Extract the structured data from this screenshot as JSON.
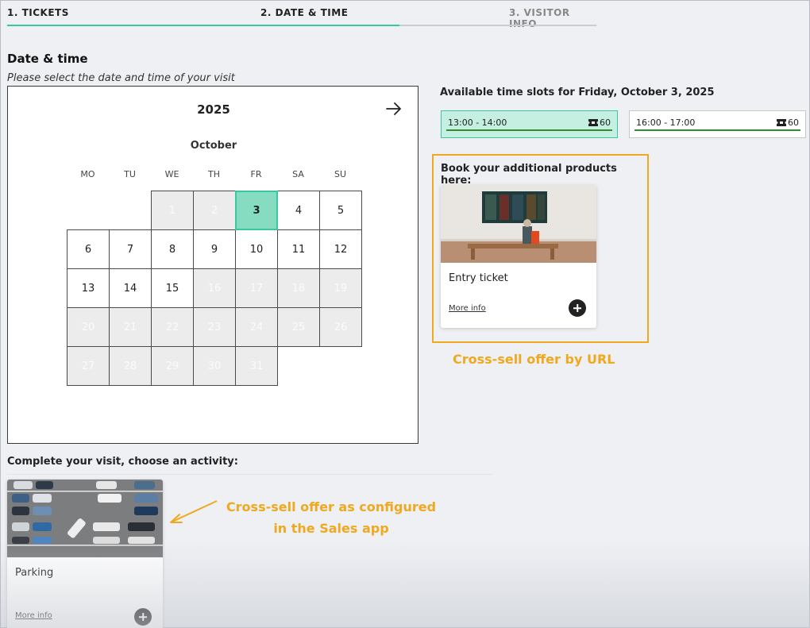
{
  "steps": [
    {
      "label": "1. TICKETS"
    },
    {
      "label": "2. DATE & TIME"
    },
    {
      "label": "3. VISITOR INFO"
    }
  ],
  "progress_fraction": 0.666,
  "section": {
    "title": "Date & time",
    "subtitle": "Please select the date and time of your visit"
  },
  "calendar": {
    "year": "2025",
    "month": "October",
    "next_icon": "arrow-right-icon",
    "weekdays": [
      "MO",
      "TU",
      "WE",
      "TH",
      "FR",
      "SA",
      "SU"
    ],
    "days": [
      {
        "d": "1",
        "col": 2,
        "row": 0,
        "state": "disabled"
      },
      {
        "d": "2",
        "col": 3,
        "row": 0,
        "state": "disabled"
      },
      {
        "d": "3",
        "col": 4,
        "row": 0,
        "state": "selected"
      },
      {
        "d": "4",
        "col": 5,
        "row": 0,
        "state": "available"
      },
      {
        "d": "5",
        "col": 6,
        "row": 0,
        "state": "available"
      },
      {
        "d": "6",
        "col": 0,
        "row": 1,
        "state": "available"
      },
      {
        "d": "7",
        "col": 1,
        "row": 1,
        "state": "available"
      },
      {
        "d": "8",
        "col": 2,
        "row": 1,
        "state": "available"
      },
      {
        "d": "9",
        "col": 3,
        "row": 1,
        "state": "available"
      },
      {
        "d": "10",
        "col": 4,
        "row": 1,
        "state": "available"
      },
      {
        "d": "11",
        "col": 5,
        "row": 1,
        "state": "available"
      },
      {
        "d": "12",
        "col": 6,
        "row": 1,
        "state": "available"
      },
      {
        "d": "13",
        "col": 0,
        "row": 2,
        "state": "available"
      },
      {
        "d": "14",
        "col": 1,
        "row": 2,
        "state": "available"
      },
      {
        "d": "15",
        "col": 2,
        "row": 2,
        "state": "available"
      },
      {
        "d": "16",
        "col": 3,
        "row": 2,
        "state": "disabled"
      },
      {
        "d": "17",
        "col": 4,
        "row": 2,
        "state": "disabled"
      },
      {
        "d": "18",
        "col": 5,
        "row": 2,
        "state": "disabled"
      },
      {
        "d": "19",
        "col": 6,
        "row": 2,
        "state": "disabled"
      },
      {
        "d": "20",
        "col": 0,
        "row": 3,
        "state": "disabled"
      },
      {
        "d": "21",
        "col": 1,
        "row": 3,
        "state": "disabled"
      },
      {
        "d": "22",
        "col": 2,
        "row": 3,
        "state": "disabled"
      },
      {
        "d": "23",
        "col": 3,
        "row": 3,
        "state": "disabled"
      },
      {
        "d": "24",
        "col": 4,
        "row": 3,
        "state": "disabled"
      },
      {
        "d": "25",
        "col": 5,
        "row": 3,
        "state": "disabled"
      },
      {
        "d": "26",
        "col": 6,
        "row": 3,
        "state": "disabled"
      },
      {
        "d": "27",
        "col": 0,
        "row": 4,
        "state": "disabled"
      },
      {
        "d": "28",
        "col": 1,
        "row": 4,
        "state": "disabled"
      },
      {
        "d": "29",
        "col": 2,
        "row": 4,
        "state": "disabled"
      },
      {
        "d": "30",
        "col": 3,
        "row": 4,
        "state": "disabled"
      },
      {
        "d": "31",
        "col": 4,
        "row": 4,
        "state": "disabled"
      }
    ]
  },
  "time_slots": {
    "title": "Available time slots for Friday, October 3, 2025",
    "slots": [
      {
        "time": "13:00 - 14:00",
        "capacity": "60",
        "icon": "ticket-icon",
        "selected": true
      },
      {
        "time": "16:00 - 17:00",
        "capacity": "60",
        "icon": "ticket-icon",
        "selected": false
      }
    ]
  },
  "additional_products": {
    "title": "Book your additional products here:",
    "card": {
      "name": "Entry ticket",
      "more_info": "More info",
      "add_icon": "plus-icon"
    }
  },
  "activity": {
    "title": "Complete your visit, choose an activity:",
    "card": {
      "name": "Parking",
      "more_info": "More info",
      "add_icon": "plus-icon"
    }
  },
  "annotations": {
    "url_offer": "Cross-sell offer by URL",
    "sales_offer_line1": "Cross-sell offer as configured",
    "sales_offer_line2": "in the Sales app"
  },
  "colors": {
    "accent": "#3cc7a4",
    "selected_day": "#85dcc0",
    "selected_slot": "#c5efe0",
    "annotation": "#f0a91e"
  }
}
